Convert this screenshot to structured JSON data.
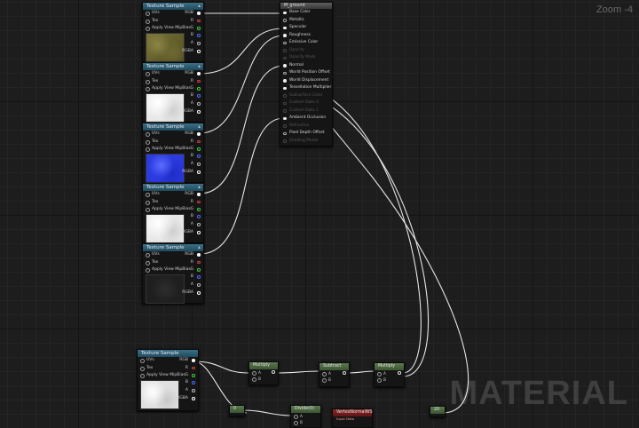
{
  "zoom_label": "Zoom -4",
  "watermark": "MATERIAL",
  "colors": {
    "pin_rgb": "#ffffff",
    "pin_r": "#e03c3c",
    "pin_g": "#3ed23e",
    "pin_b": "#4a6cff",
    "pin_a": "#bbbbbb",
    "pin_rgba": "#ffffff",
    "header_blue": "#2c5d74",
    "header_green": "#4c6a40",
    "header_red": "#7a1e1e"
  },
  "texture_samples": [
    {
      "title": "Texture Sample",
      "inputs": [
        "UVs",
        "Tex",
        "Apply View MipBias"
      ],
      "outputs": [
        "RGB",
        "R",
        "G",
        "B",
        "A",
        "RGBA"
      ],
      "preview": "ground-albedo"
    },
    {
      "title": "Texture Sample",
      "inputs": [
        "UVs",
        "Tex",
        "Apply View MipBias"
      ],
      "outputs": [
        "RGB",
        "R",
        "G",
        "B",
        "A",
        "RGBA"
      ],
      "preview": "white-mask"
    },
    {
      "title": "Texture Sample",
      "inputs": [
        "UVs",
        "Tex",
        "Apply View MipBias"
      ],
      "outputs": [
        "RGB",
        "R",
        "G",
        "B",
        "A",
        "RGBA"
      ],
      "preview": "normal-map"
    },
    {
      "title": "Texture Sample",
      "inputs": [
        "UVs",
        "Tex",
        "Apply View MipBias"
      ],
      "outputs": [
        "RGB",
        "R",
        "G",
        "B",
        "A",
        "RGBA"
      ],
      "preview": "white-mask"
    },
    {
      "title": "Texture Sample",
      "inputs": [
        "UVs",
        "Tex",
        "Apply View MipBias"
      ],
      "outputs": [
        "RGB",
        "R",
        "G",
        "B",
        "A",
        "RGBA"
      ],
      "preview": "dark"
    },
    {
      "title": "Texture Sample",
      "inputs": [
        "UVs",
        "Tex",
        "Apply View MipBias"
      ],
      "outputs": [
        "RGB",
        "R",
        "G",
        "B",
        "A",
        "RGBA"
      ],
      "preview": "white-mask"
    }
  ],
  "material_node": {
    "title": "M_ground",
    "inputs": [
      {
        "label": "Base Color",
        "enabled": true,
        "connected": true
      },
      {
        "label": "Metallic",
        "enabled": true,
        "connected": false
      },
      {
        "label": "Specular",
        "enabled": true,
        "connected": true
      },
      {
        "label": "Roughness",
        "enabled": true,
        "connected": true
      },
      {
        "label": "Emissive Color",
        "enabled": true,
        "connected": false
      },
      {
        "label": "Opacity",
        "enabled": false,
        "connected": false
      },
      {
        "label": "Opacity Mask",
        "enabled": false,
        "connected": false
      },
      {
        "label": "Normal",
        "enabled": true,
        "connected": true
      },
      {
        "label": "World Position Offset",
        "enabled": true,
        "connected": false
      },
      {
        "label": "World Displacement",
        "enabled": true,
        "connected": true
      },
      {
        "label": "Tessellation Multiplier",
        "enabled": true,
        "connected": true
      },
      {
        "label": "Subsurface Color",
        "enabled": false,
        "connected": false
      },
      {
        "label": "Custom Data 0",
        "enabled": false,
        "connected": false
      },
      {
        "label": "Custom Data 1",
        "enabled": false,
        "connected": false
      },
      {
        "label": "Ambient Occlusion",
        "enabled": true,
        "connected": true
      },
      {
        "label": "Refraction",
        "enabled": false,
        "connected": false
      },
      {
        "label": "Pixel Depth Offset",
        "enabled": true,
        "connected": false
      },
      {
        "label": "Shading Model",
        "enabled": false,
        "connected": false
      }
    ]
  },
  "math_nodes": [
    {
      "title": "Multiply",
      "inputs": [
        "A",
        "B"
      ]
    },
    {
      "title": "Subtract",
      "inputs": [
        "A",
        "B"
      ]
    },
    {
      "title": "Multiply",
      "inputs": [
        "A",
        "B"
      ]
    },
    {
      "title": "0",
      "inputs": []
    },
    {
      "title": "Divide(0)",
      "inputs": [
        "A",
        "B"
      ]
    },
    {
      "title": "VertexNormalWS",
      "inputs": [],
      "subtitle": "Input Data"
    },
    {
      "title": "20",
      "inputs": []
    }
  ]
}
